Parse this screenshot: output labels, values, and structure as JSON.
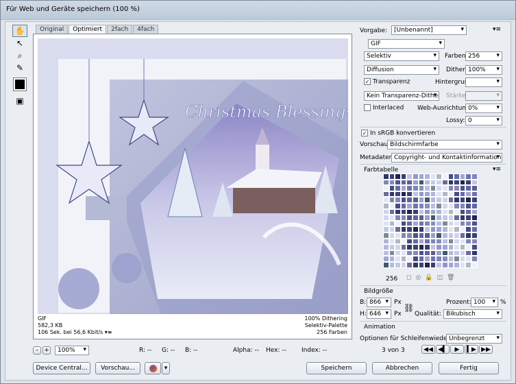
{
  "window": {
    "title": "Für Web und Geräte speichern (100 %)"
  },
  "tools": [
    {
      "name": "hand-tool-icon",
      "glyph": "✋"
    },
    {
      "name": "slice-select-tool-icon",
      "glyph": "↖"
    },
    {
      "name": "zoom-tool-icon",
      "glyph": "🔍"
    },
    {
      "name": "eyedropper-tool-icon",
      "glyph": "✎"
    }
  ],
  "tabs": [
    {
      "label": "Original"
    },
    {
      "label": "Optimiert"
    },
    {
      "label": "2fach"
    },
    {
      "label": "4fach"
    }
  ],
  "preview": {
    "image_title": "Christmas Blessings",
    "status_left": [
      "GIF",
      "582,3 KB",
      "106 Sek. bei 56,6 Kbit/s"
    ],
    "status_right": [
      "100% Dithering",
      "Selektiv-Palette",
      "256 Farben"
    ]
  },
  "bottom_bar": {
    "zoom": "100%",
    "readouts": [
      "R: --",
      "G: --",
      "B: --",
      "Alpha: --",
      "Hex: --",
      "Index: --"
    ]
  },
  "settings": {
    "vorgabe_label": "Vorgabe:",
    "vorgabe_value": "[Unbenannt]",
    "format": "GIF",
    "reduction": "Selektiv",
    "farben_label": "Farben:",
    "farben_value": "256",
    "dither_algo": "Diffusion",
    "dither_label": "Dither:",
    "dither_value": "100%",
    "transparenz_label": "Transparenz",
    "transparenz_checked": true,
    "hintergrund_label": "Hintergrund:",
    "transp_dither": "Kein Transparenz-Dither",
    "staerke_label": "Stärke:",
    "interlaced_label": "Interlaced",
    "interlaced_checked": false,
    "web_label": "Web-Ausrichtung:",
    "web_value": "0%",
    "lossy_label": "Lossy:",
    "lossy_value": "0",
    "srgb_label": "In sRGB konvertieren",
    "srgb_checked": true,
    "vorschau_label": "Vorschau:",
    "vorschau_value": "Bildschirmfarbe",
    "metadaten_label": "Metadaten:",
    "metadaten_value": "Copyright- und Kontaktinformationen"
  },
  "color_table": {
    "title": "Farbtabelle",
    "count": "256",
    "palette": [
      "#2f3768",
      "#4a5290",
      "#6b74b2",
      "#8f97cc",
      "#b3b9e0",
      "#d3d7ee",
      "#eef0f8",
      "#3b4278",
      "#5c66a4",
      "#7c86c0",
      "#9ea6d6",
      "#c4c9e8",
      "#e1e4f3",
      "#444c86",
      "#1f2450",
      "#5a5f8a",
      "#8a8fb8",
      "#aeb4d8",
      "#cfd4ec",
      "#7e87b8",
      "#626ca8",
      "#3a3f6e",
      "#9aa2c8",
      "#b8bfe4",
      "#dfe3f4",
      "#6e6a9a",
      "#8c86b4",
      "#a9a3cc",
      "#c6c1e0",
      "#3d5a6a",
      "#7a8c90",
      "#b0b8c0"
    ]
  },
  "image_size": {
    "title": "Bildgröße",
    "b_label": "B:",
    "b_value": "866",
    "h_label": "H:",
    "h_value": "646",
    "unit": "Px",
    "prozent_label": "Prozent:",
    "prozent_value": "100",
    "prozent_unit": "%",
    "qualitaet_label": "Qualität:",
    "qualitaet_value": "Bikubisch"
  },
  "animation": {
    "title": "Animation",
    "loop_label": "Optionen für Schleifenwiedergabe:",
    "loop_value": "Unbegrenzt",
    "frame": "3 von 3"
  },
  "buttons": {
    "device_central": "Device Central...",
    "vorschau": "Vorschau...",
    "speichern": "Speichern",
    "abbrechen": "Abbrechen",
    "fertig": "Fertig"
  }
}
